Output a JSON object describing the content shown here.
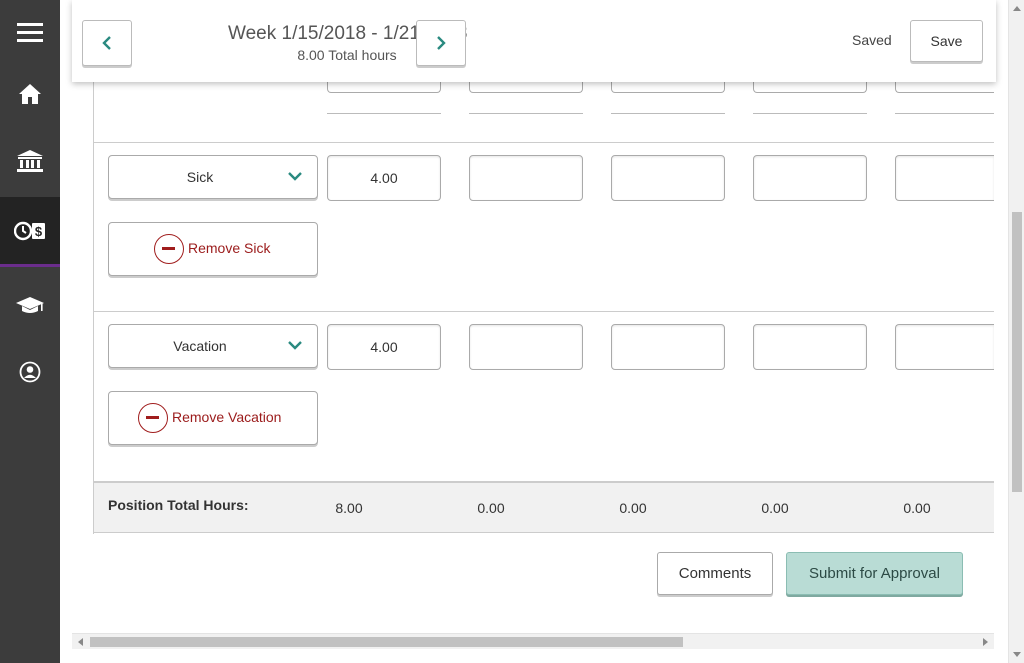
{
  "header": {
    "week_title": "Week 1/15/2018 - 1/21/2018",
    "total_hours": "8.00 Total hours",
    "saved_status": "Saved",
    "save_label": "Save"
  },
  "sidebar": {
    "items": [
      {
        "icon": "menu-icon"
      },
      {
        "icon": "home-icon"
      },
      {
        "icon": "bank-icon"
      },
      {
        "icon": "time-money-icon",
        "active": true
      },
      {
        "icon": "graduation-cap-icon"
      },
      {
        "icon": "user-profile-icon"
      }
    ]
  },
  "rows": [
    {
      "type": "Sick",
      "hours": [
        "4.00",
        "",
        "",
        "",
        ""
      ],
      "remove_label": "Remove Sick"
    },
    {
      "type": "Vacation",
      "hours": [
        "4.00",
        "",
        "",
        "",
        ""
      ],
      "remove_label": "Remove Vacation"
    }
  ],
  "totals": {
    "label": "Position Total Hours:",
    "values": [
      "8.00",
      "0.00",
      "0.00",
      "0.00",
      "0.00"
    ]
  },
  "actions": {
    "comments_label": "Comments",
    "submit_label": "Submit for Approval"
  },
  "colors": {
    "accent": "#2a8a80",
    "remove": "#9b1b1b",
    "submit_bg": "#b9dcd5",
    "sidebar": "#3c3c3c",
    "active_indicator": "#6b2d8c"
  }
}
